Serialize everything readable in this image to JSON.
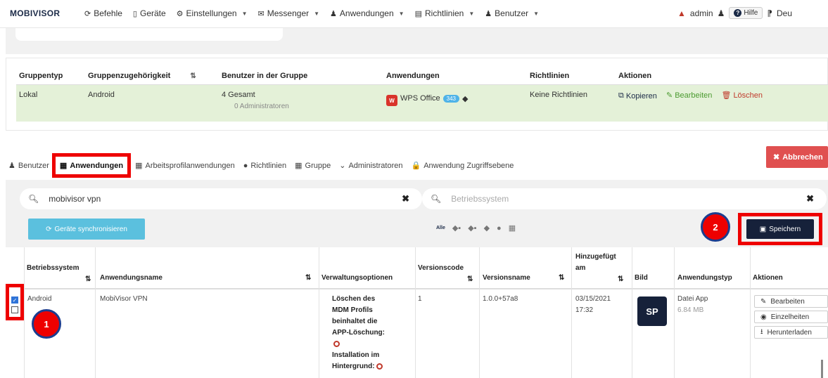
{
  "nav": {
    "brand": "MOBIVISOR",
    "items": [
      {
        "icon": "terminal-icon",
        "glyph": "⟳",
        "label": "Befehle",
        "caret": false
      },
      {
        "icon": "device-icon",
        "glyph": "▯",
        "label": "Geräte",
        "caret": false
      },
      {
        "icon": "gear-icon",
        "glyph": "⚙",
        "label": "Einstellungen",
        "caret": true
      },
      {
        "icon": "envelope-icon",
        "glyph": "✉",
        "label": "Messenger",
        "caret": true
      },
      {
        "icon": "user-icon",
        "glyph": "♟",
        "label": "Anwendungen",
        "caret": true
      },
      {
        "icon": "list-icon",
        "glyph": "▤",
        "label": "Richtlinien",
        "caret": true
      },
      {
        "icon": "user-icon",
        "glyph": "♟",
        "label": "Benutzer",
        "caret": true
      }
    ],
    "user": "admin",
    "help": "Hilfe",
    "language": "Deu"
  },
  "group_table": {
    "headers": [
      "Gruppentyp",
      "Gruppenzugehörigkeit",
      "Benutzer in der Gruppe",
      "Anwendungen",
      "Richtlinien",
      "Aktionen"
    ],
    "row": {
      "type": "Lokal",
      "membership": "Android",
      "users_total": "4 Gesamt",
      "users_admins": "0 Administratoren",
      "app_name": "WPS Office",
      "app_badge": "343",
      "policies": "Keine Richtlinien",
      "copy": "Kopieren",
      "edit": "Bearbeiten",
      "delete": "Löschen"
    }
  },
  "tabs": [
    {
      "icon": "user-icon",
      "glyph": "♟",
      "label": "Benutzer",
      "active": false
    },
    {
      "icon": "grid-icon",
      "glyph": "▦",
      "label": "Anwendungen",
      "active": true
    },
    {
      "icon": "grid-icon",
      "glyph": "▦",
      "label": "Arbeitsprofilanwendungen",
      "active": false
    },
    {
      "icon": "dot-icon",
      "glyph": "●",
      "label": "Richtlinien",
      "active": false
    },
    {
      "icon": "grid-icon",
      "glyph": "▦",
      "label": "Gruppe",
      "active": false
    },
    {
      "icon": "chevron-down-icon",
      "glyph": "⌄",
      "label": "Administratoren",
      "active": false
    },
    {
      "icon": "lock-icon",
      "glyph": "🔒",
      "label": "Anwendung Zugriffsebene",
      "active": false
    }
  ],
  "cancel_label": "Abbrechen",
  "filters": {
    "search_value": "mobivisor vpn",
    "os_placeholder": "Betriebssystem",
    "sync_label": "Geräte synchronisieren",
    "os_all": "Alle",
    "save_label": "Speichern"
  },
  "markers": {
    "one": "1",
    "two": "2"
  },
  "app_table": {
    "headers": {
      "os": "Betriebssystem",
      "name": "Anwendungsname",
      "options": "Verwaltungsoptionen",
      "version_code": "Versionscode",
      "version_name": "Versionsname",
      "added_1": "Hinzugefügt",
      "added_2": "am",
      "image": "Bild",
      "type": "Anwendungstyp",
      "actions": "Aktionen"
    },
    "row": {
      "os": "Android",
      "name": "MobiVisor VPN",
      "opt1": "Löschen des",
      "opt2": "MDM Profils",
      "opt3": "beinhaltet die",
      "opt4": "APP-Löschung:",
      "opt5": "Installation im",
      "opt6": "Hintergrund:",
      "version_code": "1",
      "version_name": "1.0.0+57a8",
      "date": "03/15/2021",
      "time": "17:32",
      "type": "Datei App",
      "size": "6.84 MB",
      "edit": "Bearbeiten",
      "details": "Einzelheiten",
      "download": "Herunterladen"
    }
  }
}
